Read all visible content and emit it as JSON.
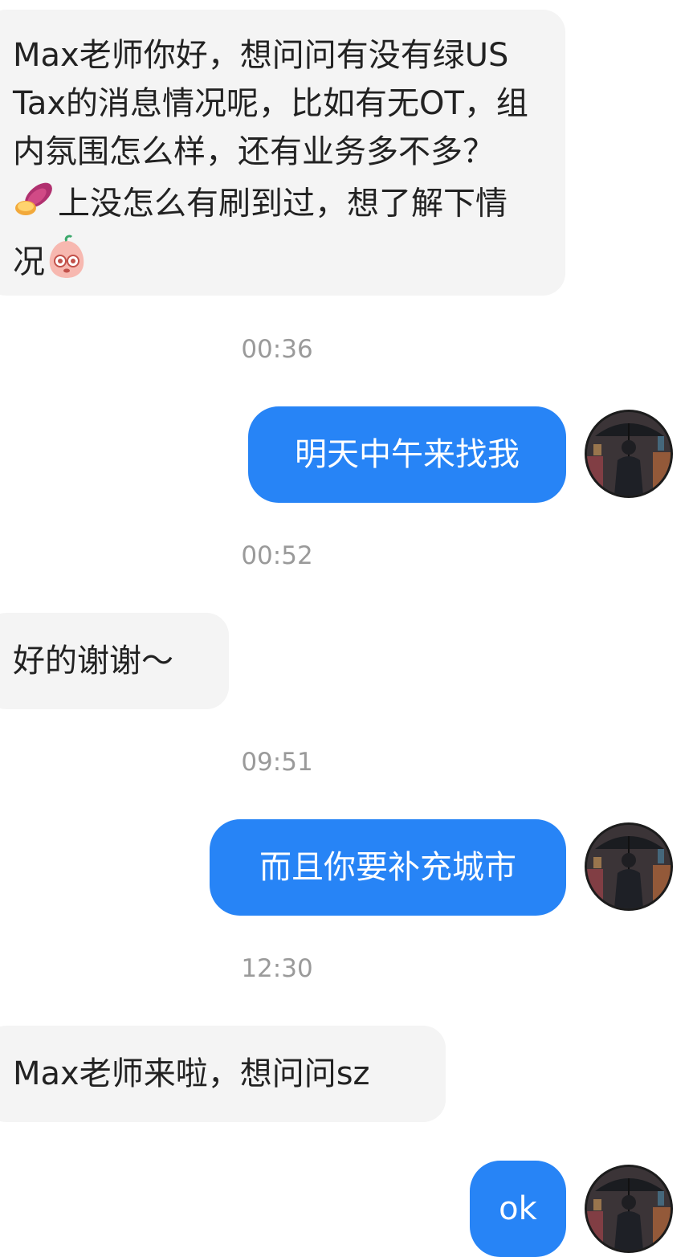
{
  "messages": [
    {
      "direction": "in",
      "text_part1": "Max老师你好，想问问有没有绿US Tax的消息情况呢，比如有无OT，组内氛围怎么样，还有业务多不多？",
      "emoji1": "sweet-potato",
      "text_part2": "上没怎么有刷到过，想了解下情况",
      "emoji2": "peach-face"
    },
    {
      "direction": "time",
      "text": "00:36"
    },
    {
      "direction": "out",
      "text": "明天中午来找我"
    },
    {
      "direction": "time",
      "text": "00:52"
    },
    {
      "direction": "in",
      "text": "好的谢谢～"
    },
    {
      "direction": "time",
      "text": "09:51"
    },
    {
      "direction": "out",
      "text": "而且你要补充城市"
    },
    {
      "direction": "time",
      "text": "12:30"
    },
    {
      "direction": "in",
      "text": "Max老师来啦，想问问sz"
    },
    {
      "direction": "out",
      "text": "ok"
    }
  ],
  "colors": {
    "outgoing_bubble": "#2784f6",
    "incoming_bubble": "#f4f4f4",
    "timestamp": "#9a9a9a"
  }
}
